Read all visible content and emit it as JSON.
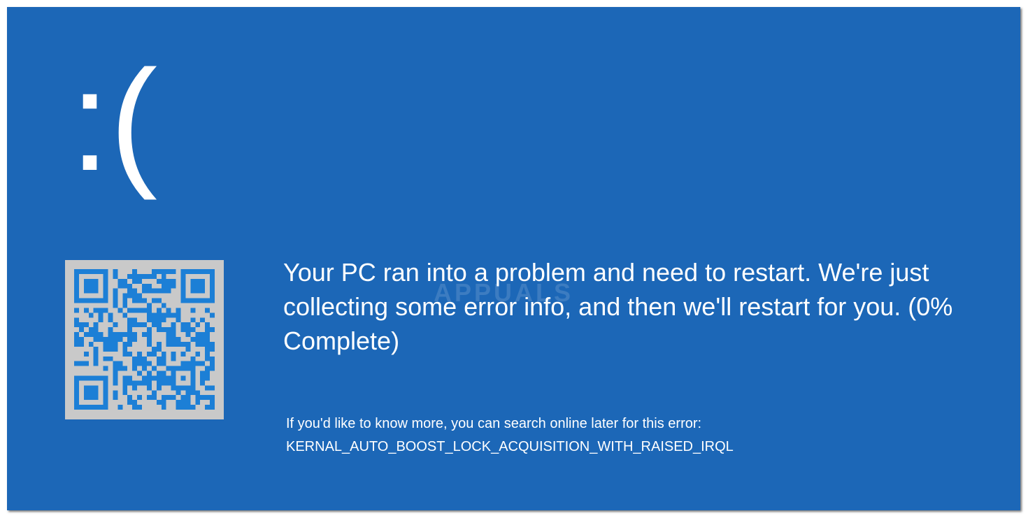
{
  "screen": {
    "background_color": "#1c67b7",
    "text_color": "#ffffff",
    "sad_face": ":(",
    "qr_code": {
      "background_color": "#c9c9c9",
      "module_color": "#1c7fd6"
    },
    "message": "Your PC ran into a problem and need to restart. We're just collecting some error info, and then we'll restart for you. (0% Complete)",
    "progress_percent": 0,
    "more_info_text": "If you'd like to know more, you can search online later for this error:",
    "stop_code": "KERNAL_AUTO_BOOST_LOCK_ACQUISITION_WITH_RAISED_IRQL",
    "watermark": "APPUALS"
  }
}
